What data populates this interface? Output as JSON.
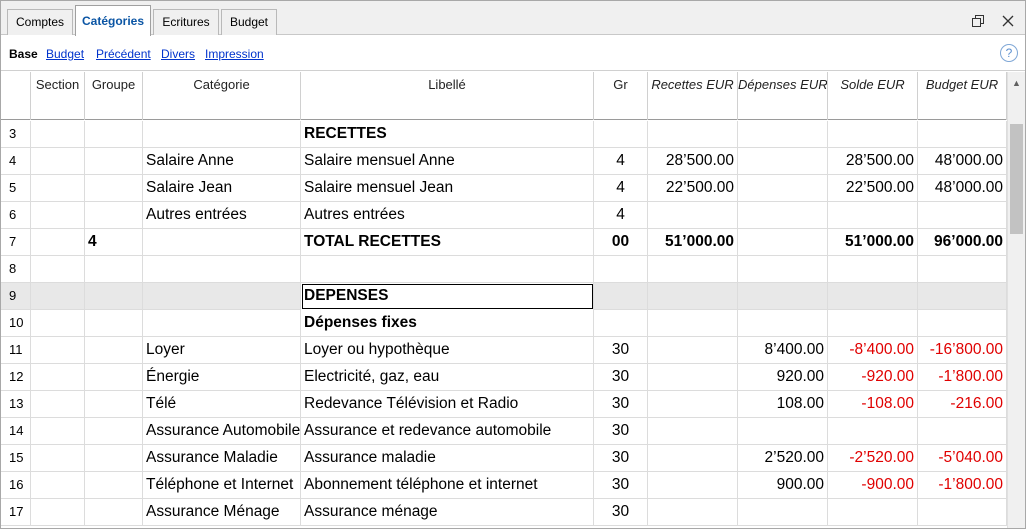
{
  "tabs": [
    {
      "label": "Comptes"
    },
    {
      "label": "Catégories"
    },
    {
      "label": "Ecritures"
    },
    {
      "label": "Budget"
    }
  ],
  "views": [
    {
      "label": "Base"
    },
    {
      "label": "Budget"
    },
    {
      "label": "Précédent"
    },
    {
      "label": "Divers"
    },
    {
      "label": "Impression"
    }
  ],
  "help_label": "?",
  "columns": {
    "section": "Section",
    "groupe": "Groupe",
    "categorie": "Catégorie",
    "libelle": "Libellé",
    "gr": "Gr",
    "recettes": "Recettes EUR",
    "depenses": "Dépenses EUR",
    "solde": "Solde EUR",
    "budget": "Budget EUR"
  },
  "rows": [
    {
      "n": "3",
      "section": "",
      "groupe": "",
      "categorie": "",
      "libelle": "RECETTES",
      "gr": "",
      "recettes": "",
      "depenses": "",
      "solde": "",
      "budget": ""
    },
    {
      "n": "4",
      "section": "",
      "groupe": "",
      "categorie": "Salaire Anne",
      "libelle": "Salaire mensuel Anne",
      "gr": "4",
      "recettes": "28’500.00",
      "depenses": "",
      "solde": "28’500.00",
      "budget": "48’000.00"
    },
    {
      "n": "5",
      "section": "",
      "groupe": "",
      "categorie": "Salaire Jean",
      "libelle": "Salaire mensuel Jean",
      "gr": "4",
      "recettes": "22’500.00",
      "depenses": "",
      "solde": "22’500.00",
      "budget": "48’000.00"
    },
    {
      "n": "6",
      "section": "",
      "groupe": "",
      "categorie": "Autres entrées",
      "libelle": "Autres entrées",
      "gr": "4",
      "recettes": "",
      "depenses": "",
      "solde": "",
      "budget": ""
    },
    {
      "n": "7",
      "section": "",
      "groupe": "4",
      "categorie": "",
      "libelle": "TOTAL RECETTES",
      "gr": "00",
      "recettes": "51’000.00",
      "depenses": "",
      "solde": "51’000.00",
      "budget": "96’000.00"
    },
    {
      "n": "8",
      "section": "",
      "groupe": "",
      "categorie": "",
      "libelle": "",
      "gr": "",
      "recettes": "",
      "depenses": "",
      "solde": "",
      "budget": ""
    },
    {
      "n": "9",
      "section": "",
      "groupe": "",
      "categorie": "",
      "libelle": "DEPENSES",
      "gr": "",
      "recettes": "",
      "depenses": "",
      "solde": "",
      "budget": ""
    },
    {
      "n": "10",
      "section": "",
      "groupe": "",
      "categorie": "",
      "libelle": "Dépenses fixes",
      "gr": "",
      "recettes": "",
      "depenses": "",
      "solde": "",
      "budget": ""
    },
    {
      "n": "11",
      "section": "",
      "groupe": "",
      "categorie": "Loyer",
      "libelle": "Loyer ou hypothèque",
      "gr": "30",
      "recettes": "",
      "depenses": "8’400.00",
      "solde": "-8’400.00",
      "budget": "-16’800.00"
    },
    {
      "n": "12",
      "section": "",
      "groupe": "",
      "categorie": "Énergie",
      "libelle": "Electricité, gaz, eau",
      "gr": "30",
      "recettes": "",
      "depenses": "920.00",
      "solde": "-920.00",
      "budget": "-1’800.00"
    },
    {
      "n": "13",
      "section": "",
      "groupe": "",
      "categorie": "Télé",
      "libelle": "Redevance Télévision et Radio",
      "gr": "30",
      "recettes": "",
      "depenses": "108.00",
      "solde": "-108.00",
      "budget": "-216.00"
    },
    {
      "n": "14",
      "section": "",
      "groupe": "",
      "categorie": "Assurance Automobile",
      "libelle": "Assurance et redevance automobile",
      "gr": "30",
      "recettes": "",
      "depenses": "",
      "solde": "",
      "budget": ""
    },
    {
      "n": "15",
      "section": "",
      "groupe": "",
      "categorie": "Assurance Maladie",
      "libelle": "Assurance maladie",
      "gr": "30",
      "recettes": "",
      "depenses": "2’520.00",
      "solde": "-2’520.00",
      "budget": "-5’040.00"
    },
    {
      "n": "16",
      "section": "",
      "groupe": "",
      "categorie": "Téléphone et Internet",
      "libelle": "Abonnement téléphone et internet",
      "gr": "30",
      "recettes": "",
      "depenses": "900.00",
      "solde": "-900.00",
      "budget": "-1’800.00"
    },
    {
      "n": "17",
      "section": "",
      "groupe": "",
      "categorie": "Assurance Ménage",
      "libelle": "Assurance ménage",
      "gr": "30",
      "recettes": "",
      "depenses": "",
      "solde": "",
      "budget": ""
    }
  ],
  "bold_rows": [
    "3",
    "7",
    "9",
    "10"
  ],
  "selected_row": "9",
  "negative_color": "#e00000",
  "accent_color": "#0b55a4"
}
